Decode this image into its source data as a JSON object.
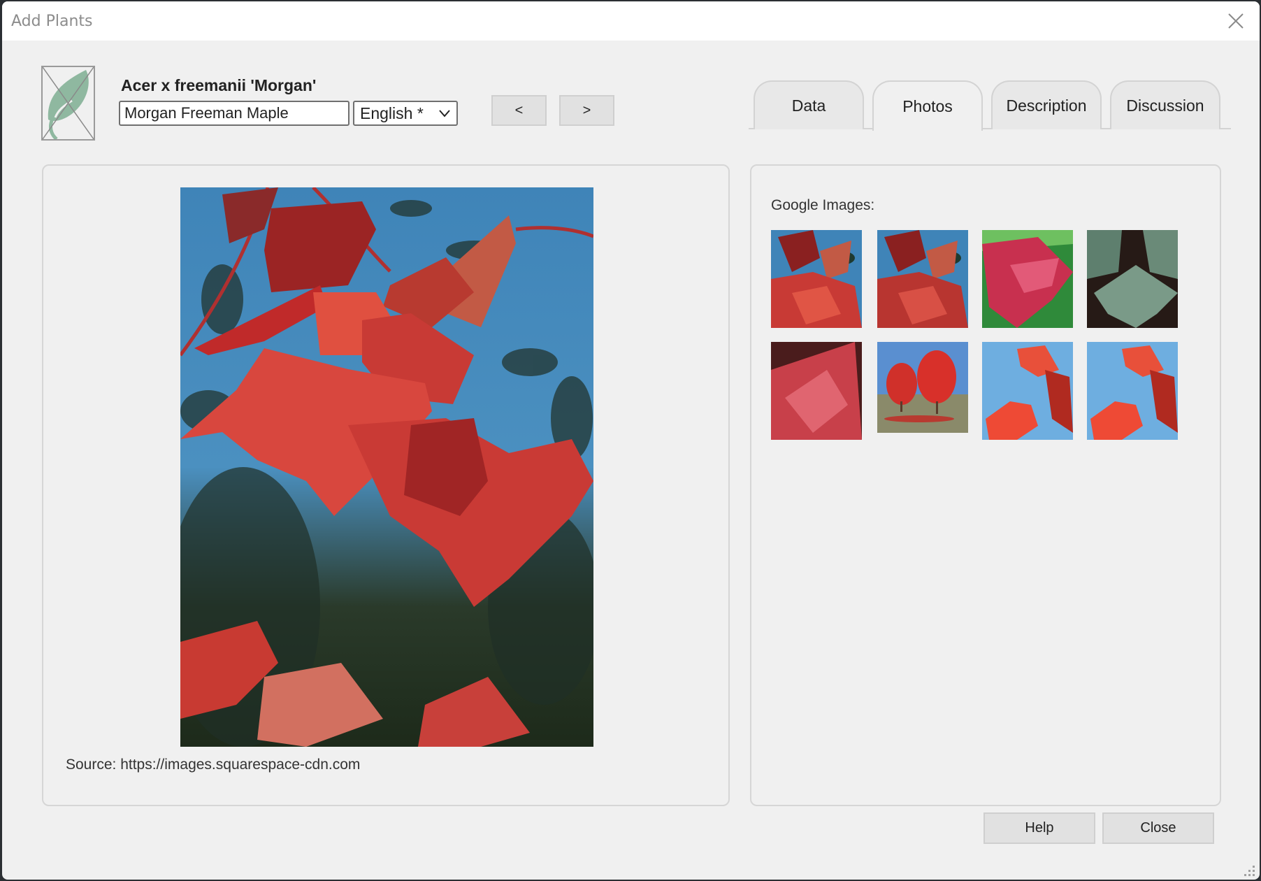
{
  "window": {
    "title": "Add Plants",
    "close_icon": "close-icon"
  },
  "plant": {
    "scientific_name": "Acer x freemanii 'Morgan'",
    "common_name": "Morgan Freeman Maple",
    "language": "English *",
    "icon": "leaf-placeholder-icon"
  },
  "nav": {
    "prev_label": "<",
    "next_label": ">"
  },
  "tabs": [
    {
      "label": "Data",
      "active": false
    },
    {
      "label": "Photos",
      "active": true
    },
    {
      "label": "Description",
      "active": false
    },
    {
      "label": "Discussion",
      "active": false
    }
  ],
  "photo": {
    "source_text": "Source: https://images.squarespace-cdn.com",
    "description": "Red maple leaves against blue sky"
  },
  "google_images": {
    "label": "Google Images:",
    "thumbnails": [
      {
        "description": "red maple leaves, blue sky"
      },
      {
        "description": "red maple leaves, blue sky (duplicate)"
      },
      {
        "description": "crimson maple leaf close-up with green background"
      },
      {
        "description": "green maple leaves on dark background"
      },
      {
        "description": "red maple leaf close-up"
      },
      {
        "description": "two red maple trees in park"
      },
      {
        "description": "red maple leaves against blue sky"
      },
      {
        "description": "red maple leaves against blue sky (duplicate)"
      }
    ]
  },
  "footer": {
    "help_label": "Help",
    "close_label": "Close"
  },
  "colors": {
    "leaf_icon": "#8fb8a0",
    "panel_bg": "#f0f0f0",
    "border": "#d6d6d6"
  }
}
